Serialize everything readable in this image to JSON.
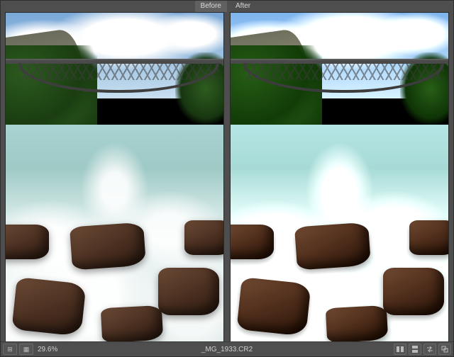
{
  "labels": {
    "before": "Before",
    "after": "After"
  },
  "status": {
    "zoom": "29.6%",
    "filename": "_MG_1933.CR2"
  },
  "icons": {
    "toggle_view": "⊞",
    "grid": "▦",
    "compare_lr": "left-right",
    "compare_tb": "top-bottom",
    "swap": "swap",
    "copy": "copy"
  }
}
